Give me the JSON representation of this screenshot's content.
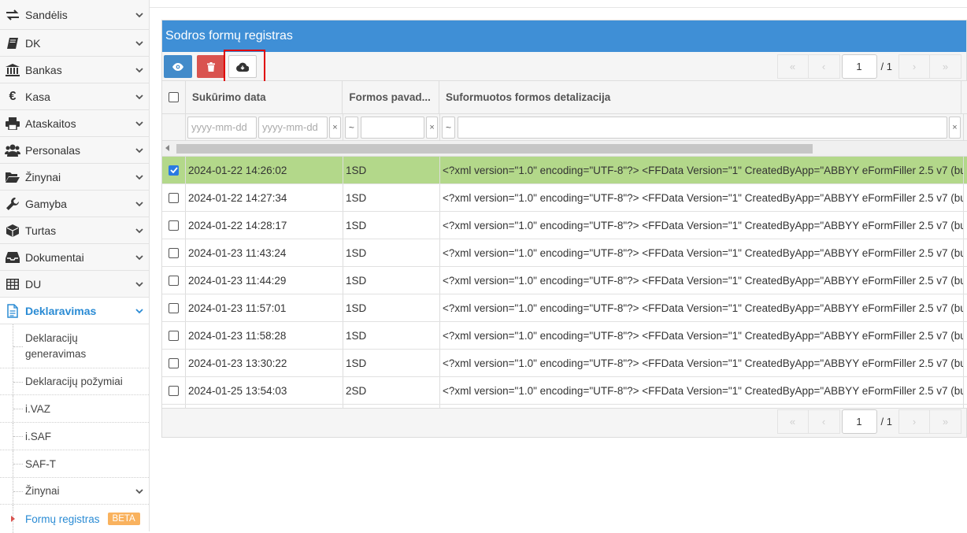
{
  "sidebar": {
    "menu": [
      {
        "label": "Sandėlis",
        "icon": "exchange-icon",
        "expanded": false
      },
      {
        "label": "DK",
        "icon": "book-icon",
        "expanded": false
      },
      {
        "label": "Bankas",
        "icon": "bank-icon",
        "expanded": false
      },
      {
        "label": "Kasa",
        "icon": "euro-icon",
        "expanded": false
      },
      {
        "label": "Ataskaitos",
        "icon": "printer-icon",
        "expanded": false
      },
      {
        "label": "Personalas",
        "icon": "users-icon",
        "expanded": false
      },
      {
        "label": "Žinynai",
        "icon": "folder-open-icon",
        "expanded": false
      },
      {
        "label": "Gamyba",
        "icon": "wrench-icon",
        "expanded": false
      },
      {
        "label": "Turtas",
        "icon": "cube-icon",
        "expanded": false
      },
      {
        "label": "Dokumentai",
        "icon": "inbox-icon",
        "expanded": false
      },
      {
        "label": "DU",
        "icon": "table-icon",
        "expanded": false
      },
      {
        "label": "Deklaravimas",
        "icon": "document-icon",
        "expanded": true
      }
    ],
    "submenu": [
      {
        "label": "Deklaracijų generavimas"
      },
      {
        "label": "Deklaracijų požymiai"
      },
      {
        "label": "i.VAZ"
      },
      {
        "label": "i.SAF"
      },
      {
        "label": "SAF-T"
      },
      {
        "label": "Žinynai",
        "has_children": true
      },
      {
        "label": "Formų registras",
        "badge": "BETA",
        "current": true
      }
    ]
  },
  "panel": {
    "title": "Sodros formų registras",
    "toolbar": {
      "view_icon": "eye-icon",
      "delete_icon": "trash-icon",
      "download_icon": "cloud-download-icon"
    },
    "pager": {
      "page": "1",
      "total": "/ 1",
      "first": "«",
      "prev": "‹",
      "next": "›",
      "last": "»"
    },
    "columns": [
      "Sukūrimo data",
      "Formos pavad...",
      "Suformuotos formos detalizacija"
    ],
    "filters": {
      "date_from_placeholder": "yyyy-mm-dd",
      "date_to_placeholder": "yyyy-mm-dd",
      "clear": "×",
      "tilde": "~"
    },
    "rows": [
      {
        "date": "2024-01-22 14:26:02",
        "form": "1SD",
        "detail": "<?xml version=\"1.0\" encoding=\"UTF-8\"?> <FFData Version=\"1\" CreatedByApp=\"ABBYY eFormFiller 2.5 v7 (bu...",
        "selected": true
      },
      {
        "date": "2024-01-22 14:27:34",
        "form": "1SD",
        "detail": "<?xml version=\"1.0\" encoding=\"UTF-8\"?> <FFData Version=\"1\" CreatedByApp=\"ABBYY eFormFiller 2.5 v7 (bu...",
        "selected": false
      },
      {
        "date": "2024-01-22 14:28:17",
        "form": "1SD",
        "detail": "<?xml version=\"1.0\" encoding=\"UTF-8\"?> <FFData Version=\"1\" CreatedByApp=\"ABBYY eFormFiller 2.5 v7 (bu...",
        "selected": false
      },
      {
        "date": "2024-01-23 11:43:24",
        "form": "1SD",
        "detail": "<?xml version=\"1.0\" encoding=\"UTF-8\"?> <FFData Version=\"1\" CreatedByApp=\"ABBYY eFormFiller 2.5 v7 (bu...",
        "selected": false
      },
      {
        "date": "2024-01-23 11:44:29",
        "form": "1SD",
        "detail": "<?xml version=\"1.0\" encoding=\"UTF-8\"?> <FFData Version=\"1\" CreatedByApp=\"ABBYY eFormFiller 2.5 v7 (bu...",
        "selected": false
      },
      {
        "date": "2024-01-23 11:57:01",
        "form": "1SD",
        "detail": "<?xml version=\"1.0\" encoding=\"UTF-8\"?> <FFData Version=\"1\" CreatedByApp=\"ABBYY eFormFiller 2.5 v7 (bu...",
        "selected": false
      },
      {
        "date": "2024-01-23 11:58:28",
        "form": "1SD",
        "detail": "<?xml version=\"1.0\" encoding=\"UTF-8\"?> <FFData Version=\"1\" CreatedByApp=\"ABBYY eFormFiller 2.5 v7 (bu...",
        "selected": false
      },
      {
        "date": "2024-01-23 13:30:22",
        "form": "1SD",
        "detail": "<?xml version=\"1.0\" encoding=\"UTF-8\"?> <FFData Version=\"1\" CreatedByApp=\"ABBYY eFormFiller 2.5 v7 (bu...",
        "selected": false
      },
      {
        "date": "2024-01-25 13:54:03",
        "form": "2SD",
        "detail": "<?xml version=\"1.0\" encoding=\"UTF-8\"?> <FFData Version=\"1\" CreatedByApp=\"ABBYY eFormFiller 2.5 v7 (bu...",
        "selected": false
      }
    ]
  },
  "colors": {
    "header_blue": "#3f8fd6",
    "accent_blue": "#2a8bd4",
    "selected_row": "#b3d88a",
    "delete_red": "#d9534f",
    "highlight_red": "#e00000",
    "beta_orange": "#f9b25e"
  }
}
